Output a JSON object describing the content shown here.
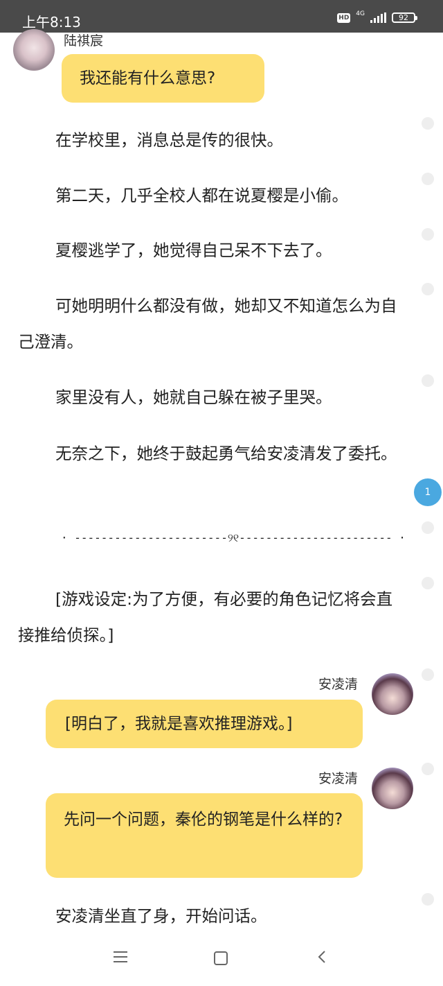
{
  "status_bar": {
    "time": "上午8:13",
    "hd": "HD",
    "network": "4G",
    "battery": "92"
  },
  "messages": [
    {
      "speaker": "陆祺宸",
      "text": "我还能有什么意思?"
    },
    {
      "speaker": "安凌清",
      "text": "[明白了，我就是喜欢推理游戏。]"
    },
    {
      "speaker": "安凌清",
      "text": "先问一个问题，秦伦的钢笔是什么样的?"
    }
  ],
  "paragraphs": [
    "在学校里，消息总是传的很快。",
    "第二天，几乎全校人都在说夏樱是小偷。",
    "夏樱逃学了，她觉得自己呆不下去了。",
    "可她明明什么都没有做，她却又不知道怎么为自己澄清。",
    "家里没有人，她就自己躲在被子里哭。",
    "无奈之下，她终于鼓起勇气给安凌清发了委托。",
    "[游戏设定:为了方便，有必要的角色记忆将会直接推给侦探。]",
    "安凌清坐直了身，开始问话。"
  ],
  "separator": "· -----------------------୨୧----------------------- ·",
  "comment_badge": "1"
}
